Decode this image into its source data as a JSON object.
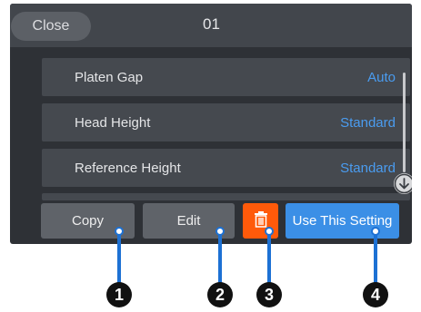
{
  "header": {
    "close_label": "Close",
    "title": "01"
  },
  "settings": [
    {
      "label": "Platen Gap",
      "value": "Auto"
    },
    {
      "label": "Head Height",
      "value": "Standard"
    },
    {
      "label": "Reference Height",
      "value": "Standard"
    }
  ],
  "actions": {
    "copy_label": "Copy",
    "edit_label": "Edit",
    "delete_icon": "trash-icon",
    "use_label": "Use This Setting"
  },
  "callouts": [
    "1",
    "2",
    "3",
    "4"
  ],
  "colors": {
    "accent": "#3b8fe6",
    "value_text": "#4a9cf0",
    "delete": "#ff5a0a",
    "callout_line": "#1d71d4"
  }
}
